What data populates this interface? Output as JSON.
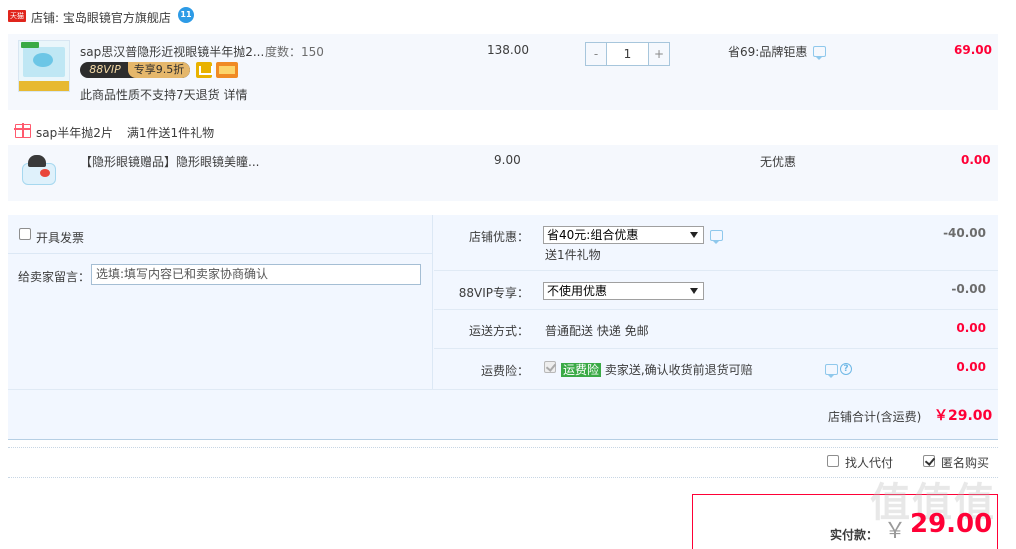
{
  "shop": {
    "badge": "天猫",
    "label": "店铺:",
    "name": "宝岛眼镜官方旗舰店",
    "wangwang": "11"
  },
  "items": [
    {
      "title": "sap思汉普隐形近视眼镜半年抛2...",
      "sku": "度数：150",
      "vip_left": "88VIP",
      "vip_right": "专享9.5折",
      "return_note": "此商品性质不支持7天退货 详情",
      "price": "138.00",
      "quantity": "1",
      "qty_minus": "-",
      "qty_plus": "+",
      "promo": "省69:品牌钜惠",
      "subtotal": "69.00"
    },
    {
      "title": "【隐形眼镜赠品】隐形眼镜美瞳...",
      "price": "9.00",
      "promo": "无优惠",
      "subtotal": "0.00"
    }
  ],
  "gift": {
    "name": "sap半年抛2片",
    "rule": "满1件送1件礼物"
  },
  "options": {
    "invoice_label": "开具发票",
    "message_label": "给卖家留言：",
    "message_placeholder": "选填:填写内容已和卖家协商确认",
    "shop_discount_label": "店铺优惠：",
    "shop_discount_value": "省40元:组合优惠",
    "shop_discount_sub": "送1件礼物",
    "shop_discount_amount": "-40.00",
    "vip_label": "88VIP专享：",
    "vip_value": "不使用优惠",
    "vip_amount": "-0.00",
    "shipping_label": "运送方式：",
    "shipping_value": "普通配送 快递 免邮",
    "shipping_amount": "0.00",
    "insurance_label": "运费险：",
    "insurance_badge": "运费险",
    "insurance_text": "卖家送,确认收货前退货可赔",
    "insurance_amount": "0.00"
  },
  "shop_total": {
    "label": "店铺合计(含运费)",
    "value": "￥29.00"
  },
  "checkout": {
    "proxy_label": "找人代付",
    "anon_label": "匿名购买",
    "anon_checked": true,
    "pay_label": "实付款：",
    "pay_currency": "￥",
    "pay_value": "29.00",
    "watermark": "值值值"
  }
}
